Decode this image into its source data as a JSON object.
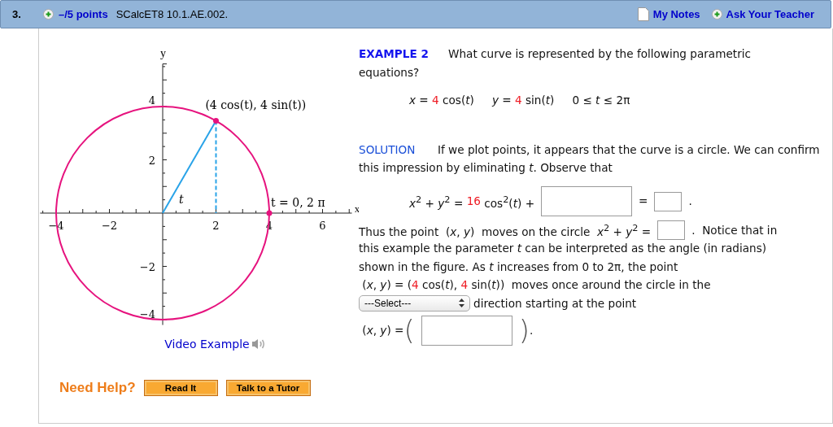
{
  "header": {
    "number": "3.",
    "points": "–/5 points",
    "code": "SCalcET8 10.1.AE.002.",
    "links": [
      {
        "label": "My Notes",
        "kind": "notes"
      },
      {
        "label": "Ask Your Teacher",
        "kind": "plus"
      }
    ]
  },
  "figure": {
    "y_axis_label": "y",
    "x_axis_label": "x",
    "x_ticks": [
      "−4",
      "−2",
      "2",
      "4",
      "6"
    ],
    "y_ticks": [
      "4",
      "2",
      "−2",
      "−4"
    ],
    "point_label": "(4 cos(t), 4 sin(t))",
    "angle_label": "t",
    "start_label": "t = 0, 2 π"
  },
  "video_link": "Video Example",
  "help": {
    "label": "Need Help?",
    "buttons": [
      "Read It",
      "Talk to a Tutor"
    ]
  },
  "example": {
    "label": "EXAMPLE 2",
    "question": "What curve is represented by the following parametric equations?",
    "equations": [
      [
        {
          "kind": "text",
          "text": "*x* = "
        },
        {
          "kind": "red",
          "text": "4"
        },
        {
          "kind": "text",
          "text": " cos(*t*)"
        }
      ],
      [
        {
          "kind": "text",
          "text": "*y* = "
        },
        {
          "kind": "red",
          "text": "4"
        },
        {
          "kind": "text",
          "text": " sin(*t*)"
        }
      ],
      [
        {
          "kind": "text",
          "text": "0 ≤ *t* ≤ 2π"
        }
      ]
    ],
    "solution_label": "SOLUTION",
    "solution": "If we plot points, it appears that the curve is a circle. We can confirm this impression by eliminating *t*. Observe that",
    "identity": [
      {
        "kind": "text",
        "text": "*x*$^{2}$ + *y*$^{2}$ = "
      },
      {
        "kind": "red",
        "text": "16"
      },
      {
        "kind": "text",
        "text": " cos$^{2}$(*t*) +"
      },
      {
        "kind": "wide_field"
      },
      {
        "kind": "text",
        "text": "="
      },
      {
        "kind": "field"
      },
      {
        "kind": "text",
        "text": "."
      }
    ],
    "lines": [
      [
        {
          "kind": "text",
          "text": "Thus the point  (*x*, *y*)  moves on the circle  *x*$^{2}$ + *y*$^{2}$ ="
        },
        {
          "kind": "field"
        },
        {
          "kind": "text",
          "text": ".  Notice that in"
        }
      ],
      [
        {
          "kind": "text",
          "text": "this example the parameter *t* can be interpreted as the angle (in radians)"
        }
      ],
      [
        {
          "kind": "text",
          "text": "shown in the figure. As *t* increases from 0 to 2π, the point"
        }
      ],
      [
        {
          "kind": "text",
          "text": " (*x*, *y*) = ("
        },
        {
          "kind": "red",
          "text": "4"
        },
        {
          "kind": "text",
          "text": " cos(*t*), "
        },
        {
          "kind": "red",
          "text": "4"
        },
        {
          "kind": "text",
          "text": " sin(*t*))  moves once around the circle in the"
        }
      ],
      [
        {
          "kind": "select",
          "value": "---Select---"
        },
        {
          "kind": "text",
          "text": "direction starting at the point"
        }
      ],
      [
        {
          "kind": "text",
          "text": " (*x*, *y*) ="
        },
        {
          "kind": "paren",
          "text": "("
        },
        {
          "kind": "wide_field"
        },
        {
          "kind": "paren",
          "text": ")"
        },
        {
          "kind": "text",
          "text": "."
        }
      ]
    ]
  }
}
